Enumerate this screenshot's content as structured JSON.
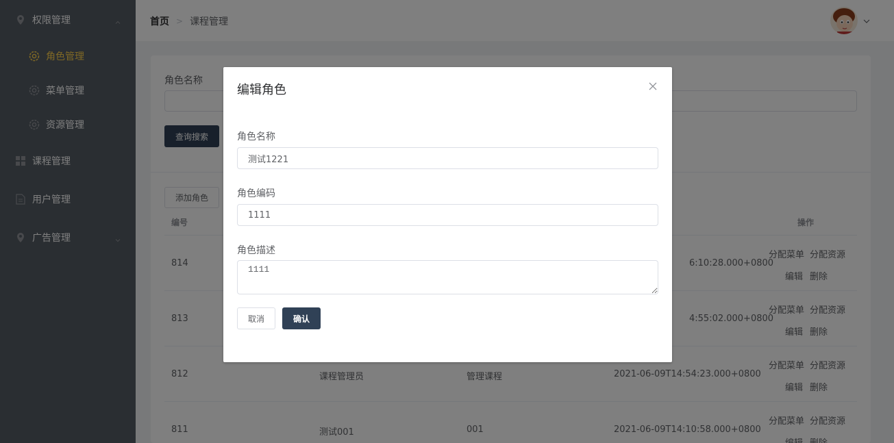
{
  "sidebar": {
    "items": [
      {
        "label": "权限管理",
        "icon": "location-icon",
        "expanded": true
      },
      {
        "label": "角色管理",
        "icon": "gear-icon",
        "active": true
      },
      {
        "label": "菜单管理",
        "icon": "gear-icon"
      },
      {
        "label": "资源管理",
        "icon": "gear-icon"
      },
      {
        "label": "课程管理",
        "icon": "grid-icon"
      },
      {
        "label": "用户管理",
        "icon": "document-icon"
      },
      {
        "label": "广告管理",
        "icon": "location-icon",
        "expanded": false
      }
    ],
    "colors": {
      "bg": "#545c64",
      "active": "#ffd04b"
    }
  },
  "header": {
    "breadcrumb": {
      "home": "首页",
      "current": "课程管理"
    }
  },
  "main": {
    "filter_label": "角色名称",
    "search_button": "查询搜索",
    "add_button": "添加角色",
    "table": {
      "headers": {
        "id": "编号",
        "actions": "操作"
      },
      "rows": [
        {
          "id": "814",
          "name": "",
          "code": "",
          "time": "6:10:28.000+0800"
        },
        {
          "id": "813",
          "name": "",
          "code": "",
          "time": "4:55:02.000+0800"
        },
        {
          "id": "812",
          "name": "课程管理员",
          "code": "管理课程",
          "time": "2021-06-09T14:54:23.000+0800"
        },
        {
          "id": "811",
          "name": "测试001",
          "code": "001",
          "time": "2021-06-09T14:10:58.000+0800"
        }
      ],
      "actions": {
        "menu": "分配菜单",
        "resource": "分配资源",
        "edit": "编辑",
        "delete": "删除"
      }
    }
  },
  "dialog": {
    "title": "编辑角色",
    "name_label": "角色名称",
    "name_value": "测试1221",
    "code_label": "角色编码",
    "code_value": "1111",
    "desc_label": "角色描述",
    "desc_value": "1111",
    "cancel": "取消",
    "confirm": "确认"
  }
}
